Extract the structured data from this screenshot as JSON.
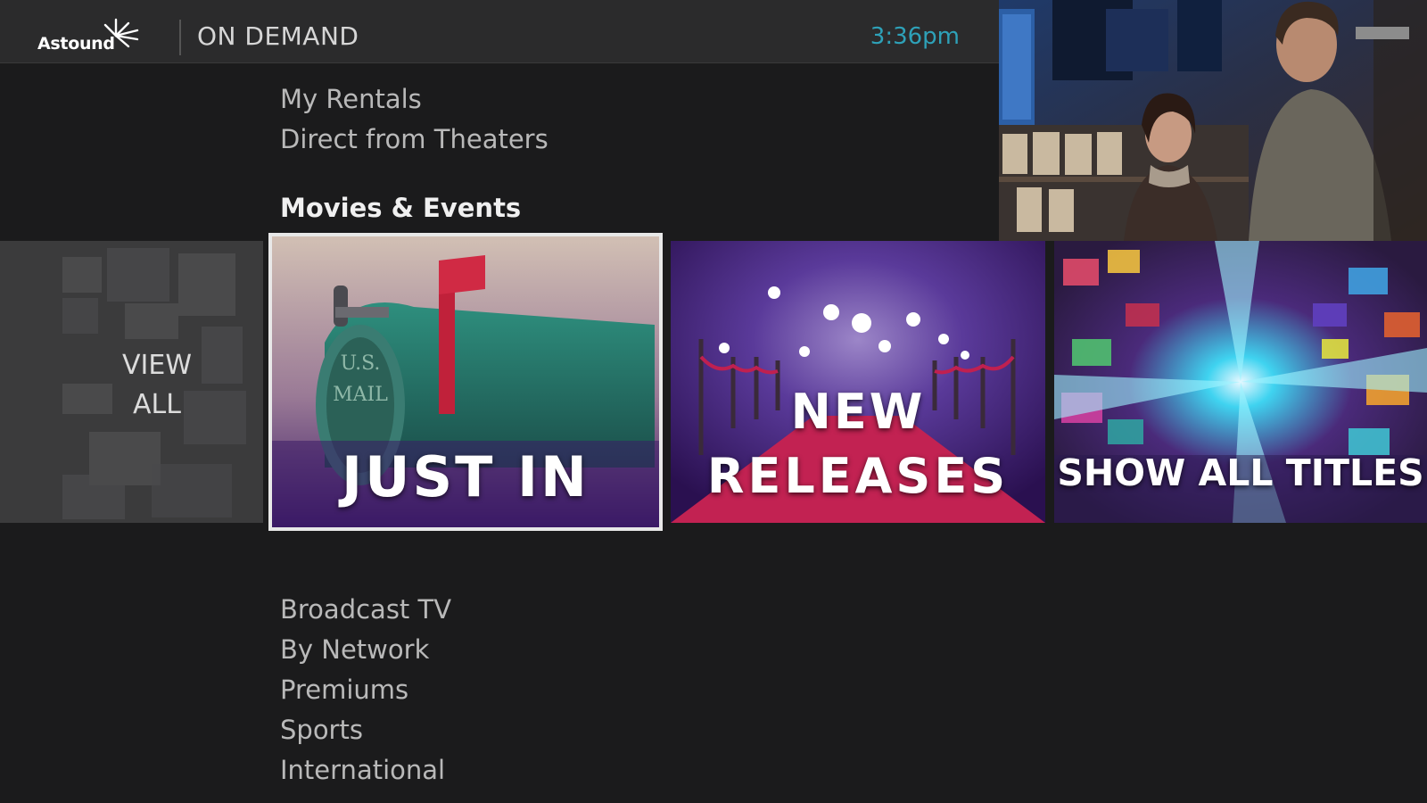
{
  "header": {
    "brand": "Astound",
    "title": "ON DEMAND",
    "time": "3:36pm"
  },
  "menu_top": [
    "My Rentals",
    "Direct from Theaters"
  ],
  "section": {
    "heading": "Movies & Events"
  },
  "tiles": {
    "view_all_line1": "VIEW",
    "view_all_line2": "ALL",
    "just_in": "JUST IN",
    "new_releases_line1": "NEW",
    "new_releases_line2": "RELEASES",
    "show_all": "SHOW ALL TITLES"
  },
  "menu_bottom": [
    "Broadcast TV",
    "By Network",
    "Premiums",
    "Sports",
    "International"
  ],
  "colors": {
    "accent_time": "#2ea1b8",
    "background": "#1b1b1c",
    "header": "#2b2b2c"
  }
}
